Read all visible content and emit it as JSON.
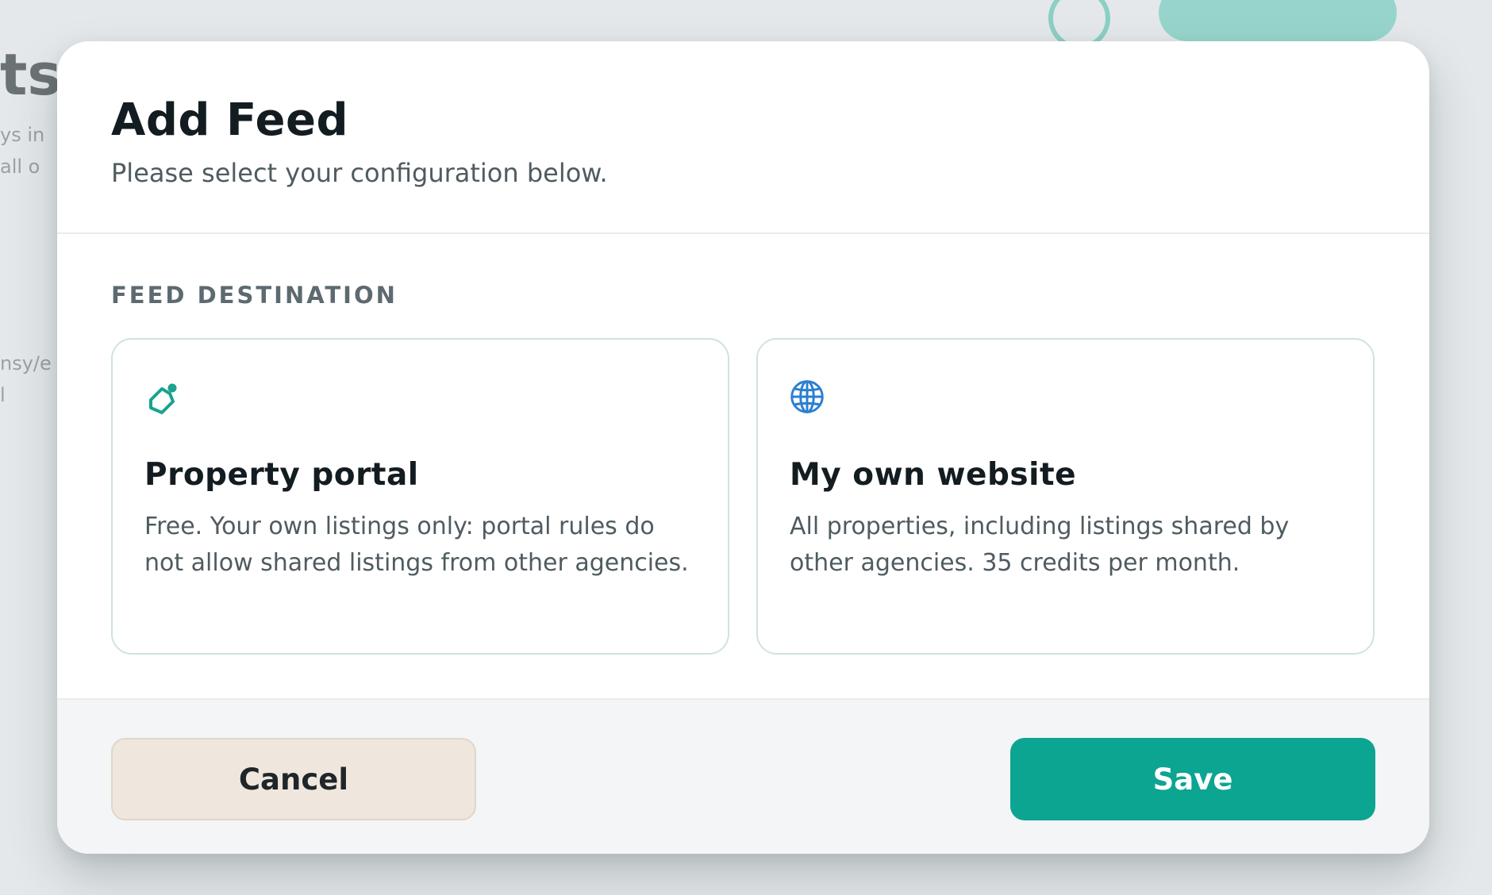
{
  "background": {
    "heading": "ts",
    "lines": [
      "ys in",
      "all o",
      "nsy/e",
      "l"
    ]
  },
  "modal": {
    "title": "Add Feed",
    "subtitle": "Please select your configuration below.",
    "section_label": "FEED DESTINATION",
    "options": [
      {
        "icon": "tag-icon",
        "title": "Property portal",
        "description": "Free. Your own listings only: portal rules do not allow shared listings from other agencies."
      },
      {
        "icon": "globe-icon",
        "title": "My own website",
        "description": "All properties, including listings shared by other agencies. 35 credits per month."
      }
    ],
    "footer": {
      "cancel_label": "Cancel",
      "save_label": "Save"
    }
  },
  "colors": {
    "accent": "#0ba592",
    "tag_icon": "#1aa38f",
    "globe_icon": "#2b7fd0",
    "cancel_bg": "#efe7de"
  }
}
